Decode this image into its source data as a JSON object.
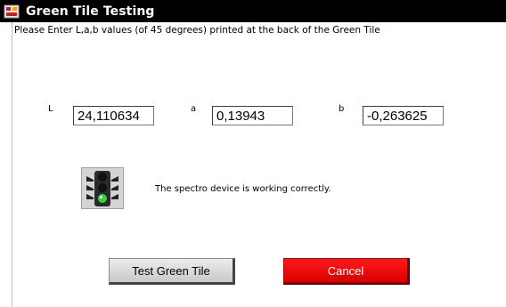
{
  "window": {
    "title": "Green Tile Testing",
    "app_icon": "app-logo-icon"
  },
  "instruction": "Please Enter L,a,b values (of 45 degrees) printed at the back of the Green Tile",
  "fields": {
    "L": {
      "label": "L",
      "value": "24,110634"
    },
    "a": {
      "label": "a",
      "value": "0,13943"
    },
    "b": {
      "label": "b",
      "value": "-0,263625"
    }
  },
  "status": {
    "icon": "traffic-light-icon",
    "active_light": "green",
    "text": "The spectro device is working correctly."
  },
  "buttons": {
    "test_label": "Test Green Tile",
    "cancel_label": "Cancel"
  },
  "colors": {
    "titlebar": "#000000",
    "cancel_button": "#ff0000",
    "status_green": "#39d439"
  }
}
